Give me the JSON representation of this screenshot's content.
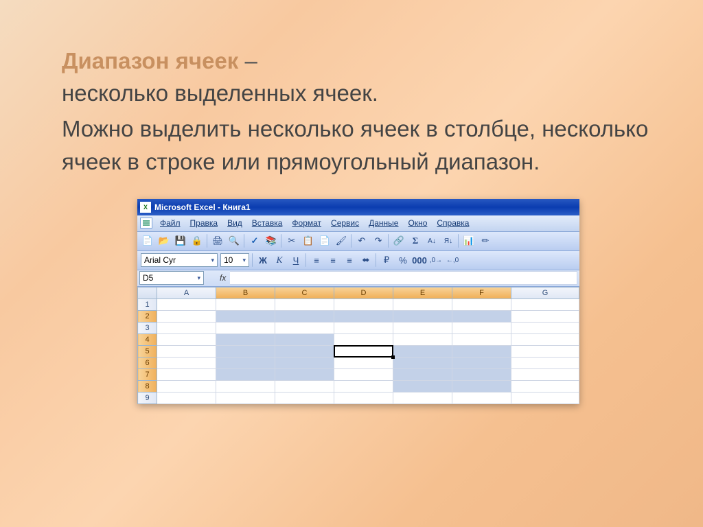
{
  "slide": {
    "title": "Диапазон ячеек",
    "dash": " –",
    "line1": "несколько выделенных ячеек.",
    "line2": "Можно выделить несколько ячеек в столбце, несколько ячеек в строке или прямоугольный диапазон."
  },
  "window": {
    "title": "Microsoft Excel - Книга1"
  },
  "menu": {
    "file": "Файл",
    "edit": "Правка",
    "view": "Вид",
    "insert": "Вставка",
    "format": "Формат",
    "tools": "Сервис",
    "data": "Данные",
    "window_m": "Окно",
    "help": "Справка"
  },
  "format_tb": {
    "font": "Arial Cyr",
    "size": "10",
    "bold": "Ж",
    "italic": "К",
    "underline": "Ч"
  },
  "namebox": "D5",
  "fx": "fx",
  "columns": [
    "A",
    "B",
    "C",
    "D",
    "E",
    "F",
    "G"
  ],
  "rows": [
    "1",
    "2",
    "3",
    "4",
    "5",
    "6",
    "7",
    "8",
    "9"
  ],
  "selected_cols": [
    "B",
    "C",
    "D",
    "E",
    "F"
  ],
  "selected_rows": [
    "2",
    "4",
    "5",
    "6",
    "7",
    "8"
  ]
}
